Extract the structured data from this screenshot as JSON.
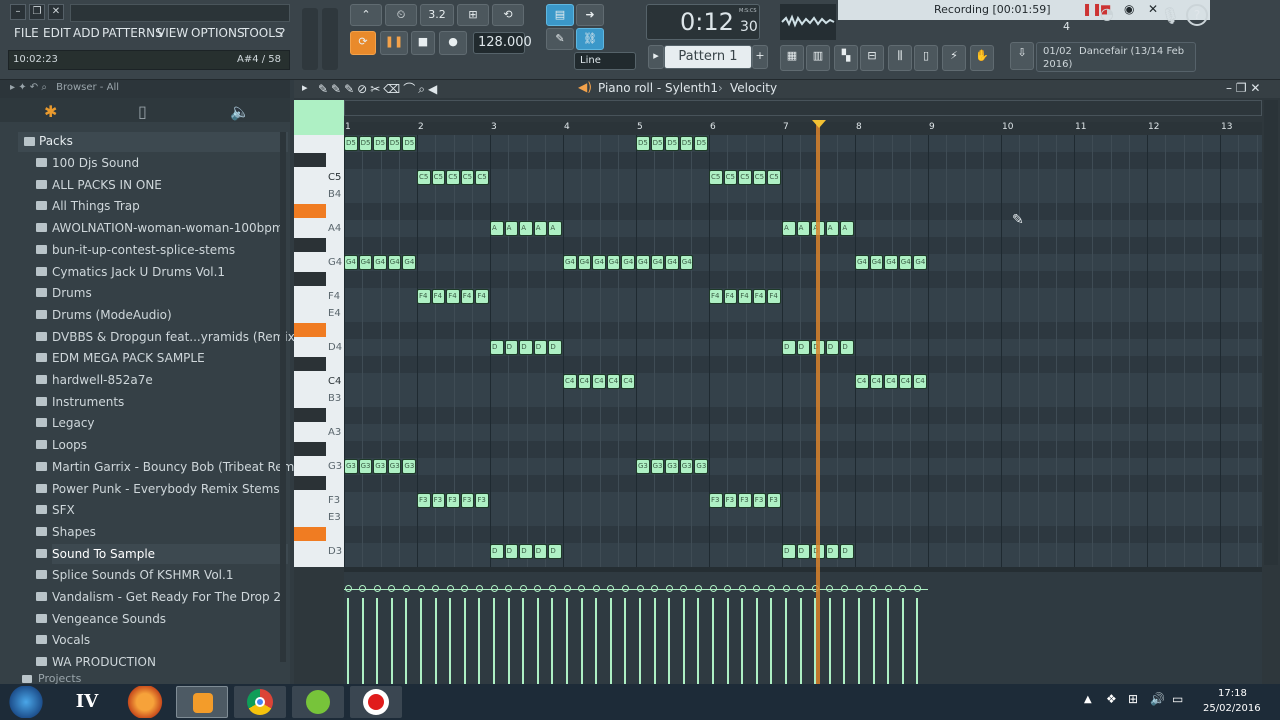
{
  "menu": [
    "FILE",
    "EDIT",
    "ADD",
    "PATTERNS",
    "VIEW",
    "OPTIONS",
    "TOOLS",
    "?"
  ],
  "hint_time": "10:02:23",
  "hint_note": "A#4 / 58",
  "transport": {
    "tempo": "128.000",
    "time": "0:12",
    "time_small": "30",
    "time_unit": "M:S:CS",
    "snap": "Line"
  },
  "pattern": "Pattern 1",
  "meter_value": "3.2",
  "recording": "Recording [00:01:59]",
  "count": "4",
  "project_info": {
    "counter": "01/02",
    "title": "Dancefair (13/14 Feb 2016)"
  },
  "browser": {
    "title": "Browser - All",
    "section": "Packs",
    "items": [
      "100 Djs Sound",
      "ALL PACKS IN ONE",
      "All Things Trap",
      "AWOLNATION-woman-woman-100bpm",
      "bun-it-up-contest-splice-stems",
      "Cymatics Jack U Drums Vol.1",
      "Drums",
      "Drums (ModeAudio)",
      "DVBBS & Dropgun feat...yramids (Remix Pack)",
      "EDM MEGA PACK SAMPLE",
      "hardwell-852a7e",
      "Instruments",
      "Legacy",
      "Loops",
      "Martin Garrix - Bouncy Bob (Tribeat Remake)",
      "Power Punk - Everybody Remix Stemss",
      "SFX",
      "Shapes",
      "Sound To Sample",
      "Splice Sounds Of KSHMR Vol.1",
      "Vandalism - Get Ready For The Drop 2",
      "Vengeance Sounds",
      "Vocals",
      "WA PRODUCTION"
    ],
    "footer": "Projects"
  },
  "pianoroll": {
    "title": "Piano roll - Sylenth1",
    "mode": "Velocity",
    "bars": [
      "1",
      "2",
      "3",
      "4",
      "5",
      "6",
      "7",
      "8",
      "9",
      "10",
      "11",
      "12",
      "13"
    ],
    "key_labels": [
      "C5",
      "B4",
      "A4",
      "G4",
      "F4",
      "E4",
      "D4",
      "C4",
      "B3",
      "A3",
      "G3",
      "F3",
      "E3",
      "D3"
    ]
  },
  "taskbar": {
    "time": "17:18",
    "date": "25/02/2016"
  },
  "colors": {
    "accent": "#3b98c9",
    "note": "#aef0c4",
    "playhead": "#d9832b",
    "highlight": "#f07c22"
  }
}
